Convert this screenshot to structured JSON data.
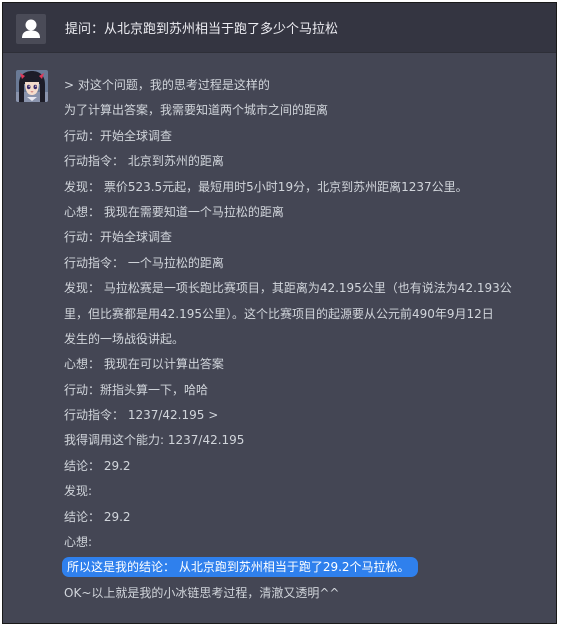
{
  "question": {
    "text": "提问：从北京跑到苏州相当于跑了多少个马拉松"
  },
  "answer": {
    "lines": [
      "> 对这个问题，我的思考过程是这样的",
      "为了计算出答案，我需要知道两个城市之间的距离",
      "行动：开始全球调查",
      "行动指令： 北京到苏州的距离",
      "发现： 票价523.5元起，最短用时5小时19分，北京到苏州距离1237公里。",
      "心想： 我现在需要知道一个马拉松的距离",
      "行动：开始全球调查",
      "行动指令： 一个马拉松的距离",
      "发现： 马拉松赛是一项长跑比赛项目，其距离为42.195公里（也有说法为42.193公",
      "里，但比赛都是用42.195公里）。这个比赛项目的起源要从公元前490年9月12日",
      "发生的一场战役讲起。",
      "心想： 我现在可以计算出答案",
      "行动：掰指头算一下，哈哈",
      "行动指令： 1237/42.195 >",
      "我得调用这个能力: 1237/42.195",
      "结论： 29.2",
      "发现:",
      "结论： 29.2",
      "心想:"
    ],
    "conclusion": "所以这是我的结论： 从北京跑到苏州相当于跑了29.2个马拉松。",
    "closing": "OK~以上就是我的小冰链思考过程，清澈又透明^^"
  },
  "colors": {
    "panel_background": "#444654",
    "question_background": "#343541",
    "text": "#d1d5db",
    "highlight": "#2f80ed"
  },
  "icons": {
    "user": "user-silhouette-icon",
    "bot": "anime-girl-avatar"
  }
}
